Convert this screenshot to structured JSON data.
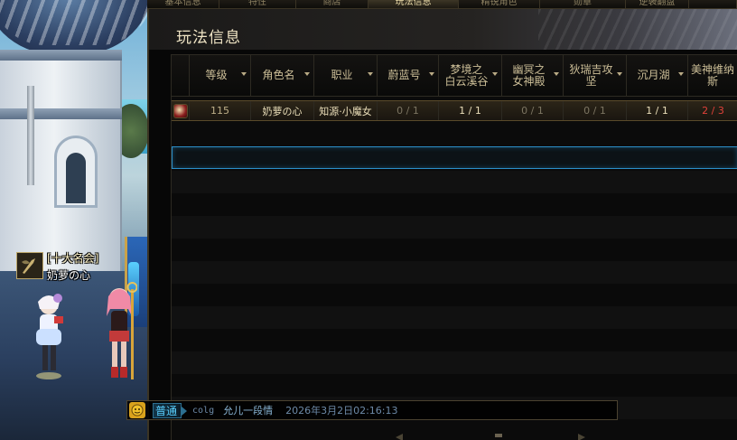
{
  "tabs": [
    {
      "label": "基本信息",
      "active": false
    },
    {
      "label": "特性",
      "active": false
    },
    {
      "label": "商店",
      "active": false
    },
    {
      "label": "玩法信息",
      "active": true
    },
    {
      "label": "精锐角色",
      "active": false
    },
    {
      "label": "勋章",
      "active": false
    },
    {
      "label": "逆袭翻盘",
      "active": false
    }
  ],
  "panel": {
    "title": "玩法信息"
  },
  "table": {
    "columns": [
      "",
      "等级",
      "角色名",
      "职业",
      "蔚蓝号",
      "梦境之\n白云溪谷",
      "幽冥之\n女神殿",
      "狄瑞吉攻\n坚",
      "沉月湖",
      "美神维纳\n斯"
    ],
    "sortable": [
      false,
      true,
      true,
      true,
      true,
      true,
      true,
      true,
      true,
      true
    ],
    "rows": [
      {
        "icon": "character-portrait-icon",
        "level": "115",
        "name": "奶萝の心",
        "job": "知源·小魔女",
        "c1": "0 / 1",
        "c2": "1 / 1",
        "c3": "0 / 1",
        "c4": "0 / 1",
        "c5": "1 / 1",
        "c6": "2 / 3"
      }
    ]
  },
  "scene": {
    "guild": "[十大名会]",
    "player": "奶萝の心"
  },
  "chat": {
    "channel": "普通",
    "user": "colg",
    "message": "允儿一段情",
    "timestamp": "2026年3月2日02:16:13"
  },
  "colors": {
    "accent_blue": "#2b8fc9",
    "gold_text": "#d9cba4",
    "red_progress": "#e0413a"
  }
}
